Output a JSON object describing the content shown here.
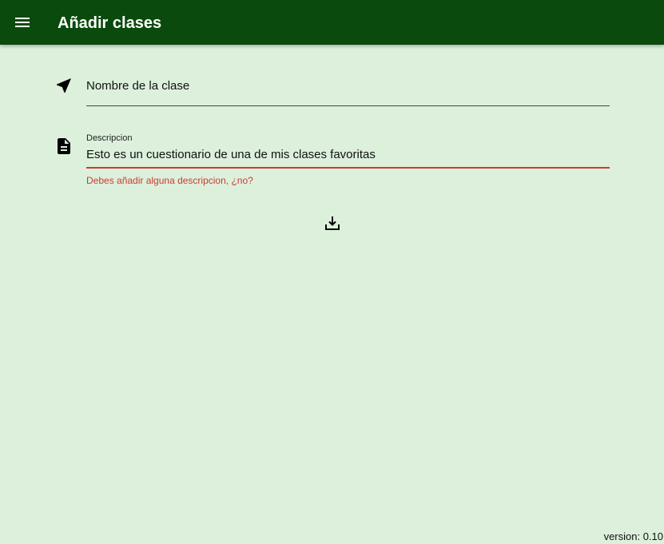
{
  "app_bar": {
    "title": "Añadir clases",
    "menu_icon": "menu-icon",
    "background_color": "#0b4a0d"
  },
  "form": {
    "nombre": {
      "icon": "navigation-arrow-icon",
      "placeholder": "Nombre de la clase",
      "value": ""
    },
    "descripcion": {
      "icon": "document-icon",
      "label": "Descripcion",
      "value": "Esto es un cuestionario de una de mis clases favoritas",
      "error": "Debes añadir alguna descripcion, ¿no?",
      "error_color": "#d03a30"
    },
    "save_icon": "download-save-icon"
  },
  "footer": {
    "version": "version: 0.10"
  },
  "colors": {
    "background": "#dcf0dc",
    "accent": "#0b4a0d"
  }
}
